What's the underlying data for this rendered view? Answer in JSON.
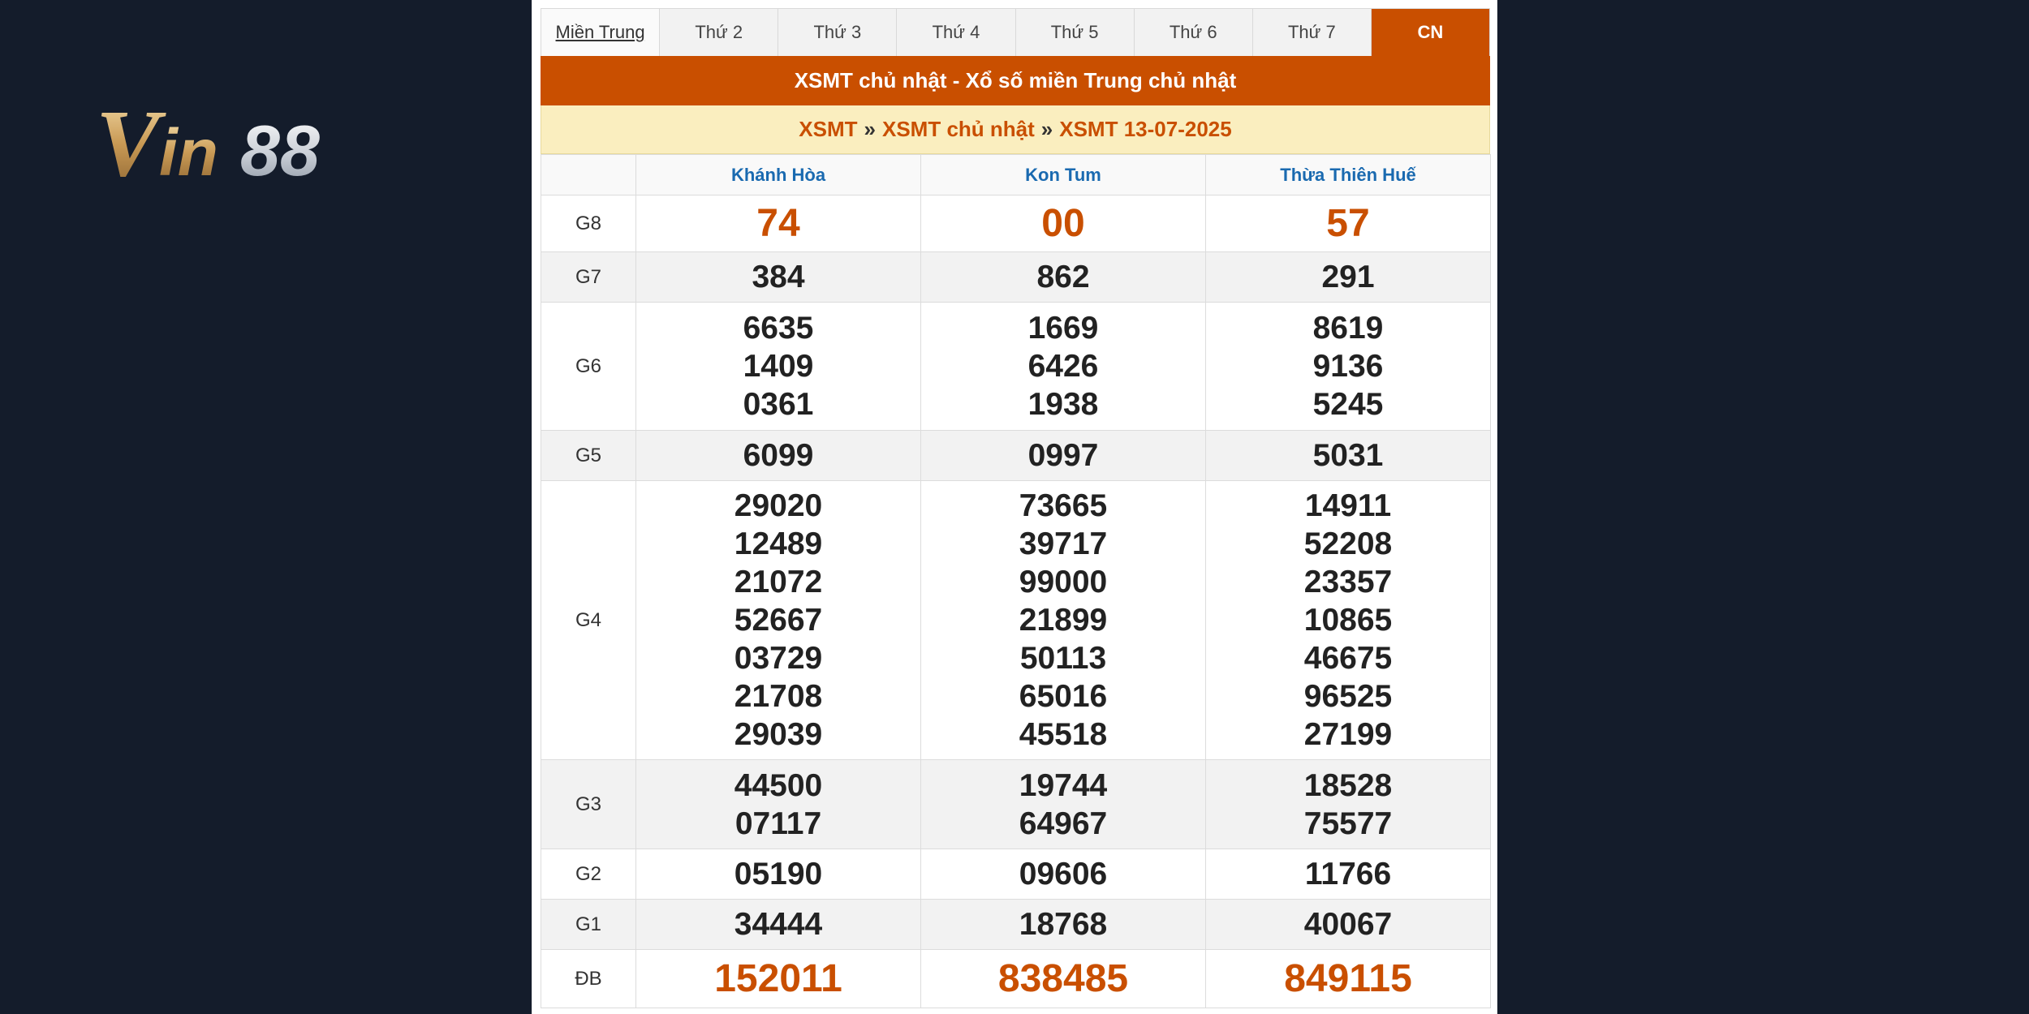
{
  "logo": {
    "text": "Vin88"
  },
  "tabs": [
    {
      "label": "Miền Trung",
      "region": true
    },
    {
      "label": "Thứ 2"
    },
    {
      "label": "Thứ 3"
    },
    {
      "label": "Thứ 4"
    },
    {
      "label": "Thứ 5"
    },
    {
      "label": "Thứ 6"
    },
    {
      "label": "Thứ 7"
    },
    {
      "label": "CN",
      "active": true
    }
  ],
  "title": "XSMT chủ nhật - Xổ số miền Trung chủ nhật",
  "breadcrumb": {
    "items": [
      "XSMT",
      "XSMT chủ nhật",
      "XSMT 13-07-2025"
    ],
    "separator": "»"
  },
  "table": {
    "provinces": [
      "Khánh Hòa",
      "Kon Tum",
      "Thừa Thiên Huế"
    ],
    "rows": [
      {
        "prize": "G8",
        "big": true,
        "values": [
          [
            "74"
          ],
          [
            "00"
          ],
          [
            "57"
          ]
        ]
      },
      {
        "prize": "G7",
        "values": [
          [
            "384"
          ],
          [
            "862"
          ],
          [
            "291"
          ]
        ]
      },
      {
        "prize": "G6",
        "values": [
          [
            "6635",
            "1409",
            "0361"
          ],
          [
            "1669",
            "6426",
            "1938"
          ],
          [
            "8619",
            "9136",
            "5245"
          ]
        ]
      },
      {
        "prize": "G5",
        "values": [
          [
            "6099"
          ],
          [
            "0997"
          ],
          [
            "5031"
          ]
        ]
      },
      {
        "prize": "G4",
        "values": [
          [
            "29020",
            "12489",
            "21072",
            "52667",
            "03729",
            "21708",
            "29039"
          ],
          [
            "73665",
            "39717",
            "99000",
            "21899",
            "50113",
            "65016",
            "45518"
          ],
          [
            "14911",
            "52208",
            "23357",
            "10865",
            "46675",
            "96525",
            "27199"
          ]
        ]
      },
      {
        "prize": "G3",
        "values": [
          [
            "44500",
            "07117"
          ],
          [
            "19744",
            "64967"
          ],
          [
            "18528",
            "75577"
          ]
        ]
      },
      {
        "prize": "G2",
        "values": [
          [
            "05190"
          ],
          [
            "09606"
          ],
          [
            "11766"
          ]
        ]
      },
      {
        "prize": "G1",
        "values": [
          [
            "34444"
          ],
          [
            "18768"
          ],
          [
            "40067"
          ]
        ]
      },
      {
        "prize": "ĐB",
        "big": true,
        "values": [
          [
            "152011"
          ],
          [
            "838485"
          ],
          [
            "849115"
          ]
        ]
      }
    ]
  },
  "colors": {
    "accent": "#c94f00",
    "header_text": "#1a6ab0",
    "breadcrumb_bg": "#faeebf",
    "background": "#141c2b"
  }
}
